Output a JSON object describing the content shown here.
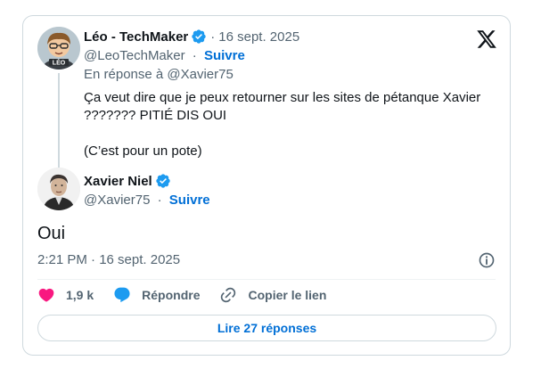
{
  "parent_tweet": {
    "display_name": "Léo - TechMaker",
    "handle": "@LeoTechMaker",
    "separator": "·",
    "date": "16 sept. 2025",
    "follow_label": "Suivre",
    "reply_to": "En réponse à @Xavier75",
    "text_line1": "Ça veut dire que je peux retourner sur les sites de pétanque Xavier ??????? PITIÉ DIS OUI",
    "text_line2": "(C’est pour un pote)",
    "avatar_badge": "LÉO"
  },
  "main_tweet": {
    "display_name": "Xavier Niel",
    "handle": "@Xavier75",
    "separator": "·",
    "follow_label": "Suivre",
    "text": "Oui",
    "timestamp": "2:21 PM · 16 sept. 2025"
  },
  "actions": {
    "like_count": "1,9 k",
    "reply_label": "Répondre",
    "copy_link_label": "Copier le lien",
    "read_replies_label": "Lire 27 réponses"
  },
  "colors": {
    "like": "#f91880",
    "reply": "#1d9bf0",
    "link_blue": "#006fd6",
    "verified": "#1d9bf0",
    "muted": "#536471",
    "border": "#cfd9de"
  },
  "icons": [
    "x-logo-icon",
    "verified-badge-icon",
    "info-icon",
    "heart-icon",
    "reply-bubble-icon",
    "link-icon"
  ]
}
